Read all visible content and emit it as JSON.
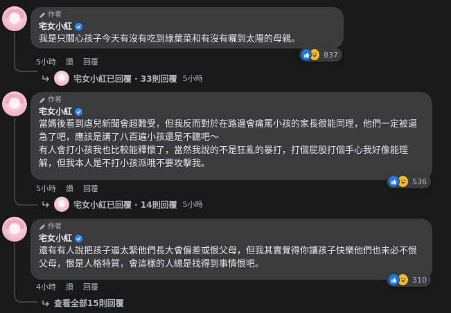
{
  "comments": [
    {
      "author_tag": "作者",
      "name": "宅女小紅",
      "text": "我是只關心孩子今天有沒有吃到綠葉菜和有沒有曬到太陽的母親。",
      "time": "5小時",
      "like": "讚",
      "reply": "回覆",
      "reaction_count": "837",
      "replies_label": "宅女小紅已回覆 · 33則回覆",
      "replies_time": "5小時"
    },
    {
      "author_tag": "作者",
      "name": "宅女小紅",
      "text": "當媽後看到虐兒新聞會超難受，但我反而對於在路邊會痛罵小孩的家長很能同理，他們一定被逼急了吧，應該是講了八百遍小孩還是不聽吧～\n有人會打小孩我也比較能釋懷了，當然我說的不是狂亂的暴打，打個屁股打個手心我好像能理解，但我本人是不打小孩派哦不要攻擊我。",
      "time": "5小時",
      "like": "讚",
      "reply": "回覆",
      "reaction_count": "536",
      "replies_label": "宅女小紅已回覆 · 14則回覆",
      "replies_time": "5小時"
    },
    {
      "author_tag": "作者",
      "name": "宅女小紅",
      "text": "還有有人說把孩子逼太緊他們長大會偏差或恨父母，但我其實覺得你讓孩子快樂他們也未必不恨父母，恨是人格特質，會這樣的人總是找得到事情恨吧。",
      "time": "4小時",
      "like": "讚",
      "reply": "回覆",
      "reaction_count": "310",
      "replies_label": "查看全部15則回覆"
    }
  ],
  "colors": {
    "background": "#18191a",
    "bubble": "#3a3b3c",
    "text": "#e4e6eb",
    "muted": "#b0b3b8",
    "like_blue": "#1877f2",
    "haha_yellow": "#f7b928",
    "verified_blue": "#2d88ff"
  },
  "icons": [
    "pencil-icon",
    "verified-badge-icon",
    "like-reaction-icon",
    "haha-reaction-icon",
    "reply-arrow-icon"
  ]
}
